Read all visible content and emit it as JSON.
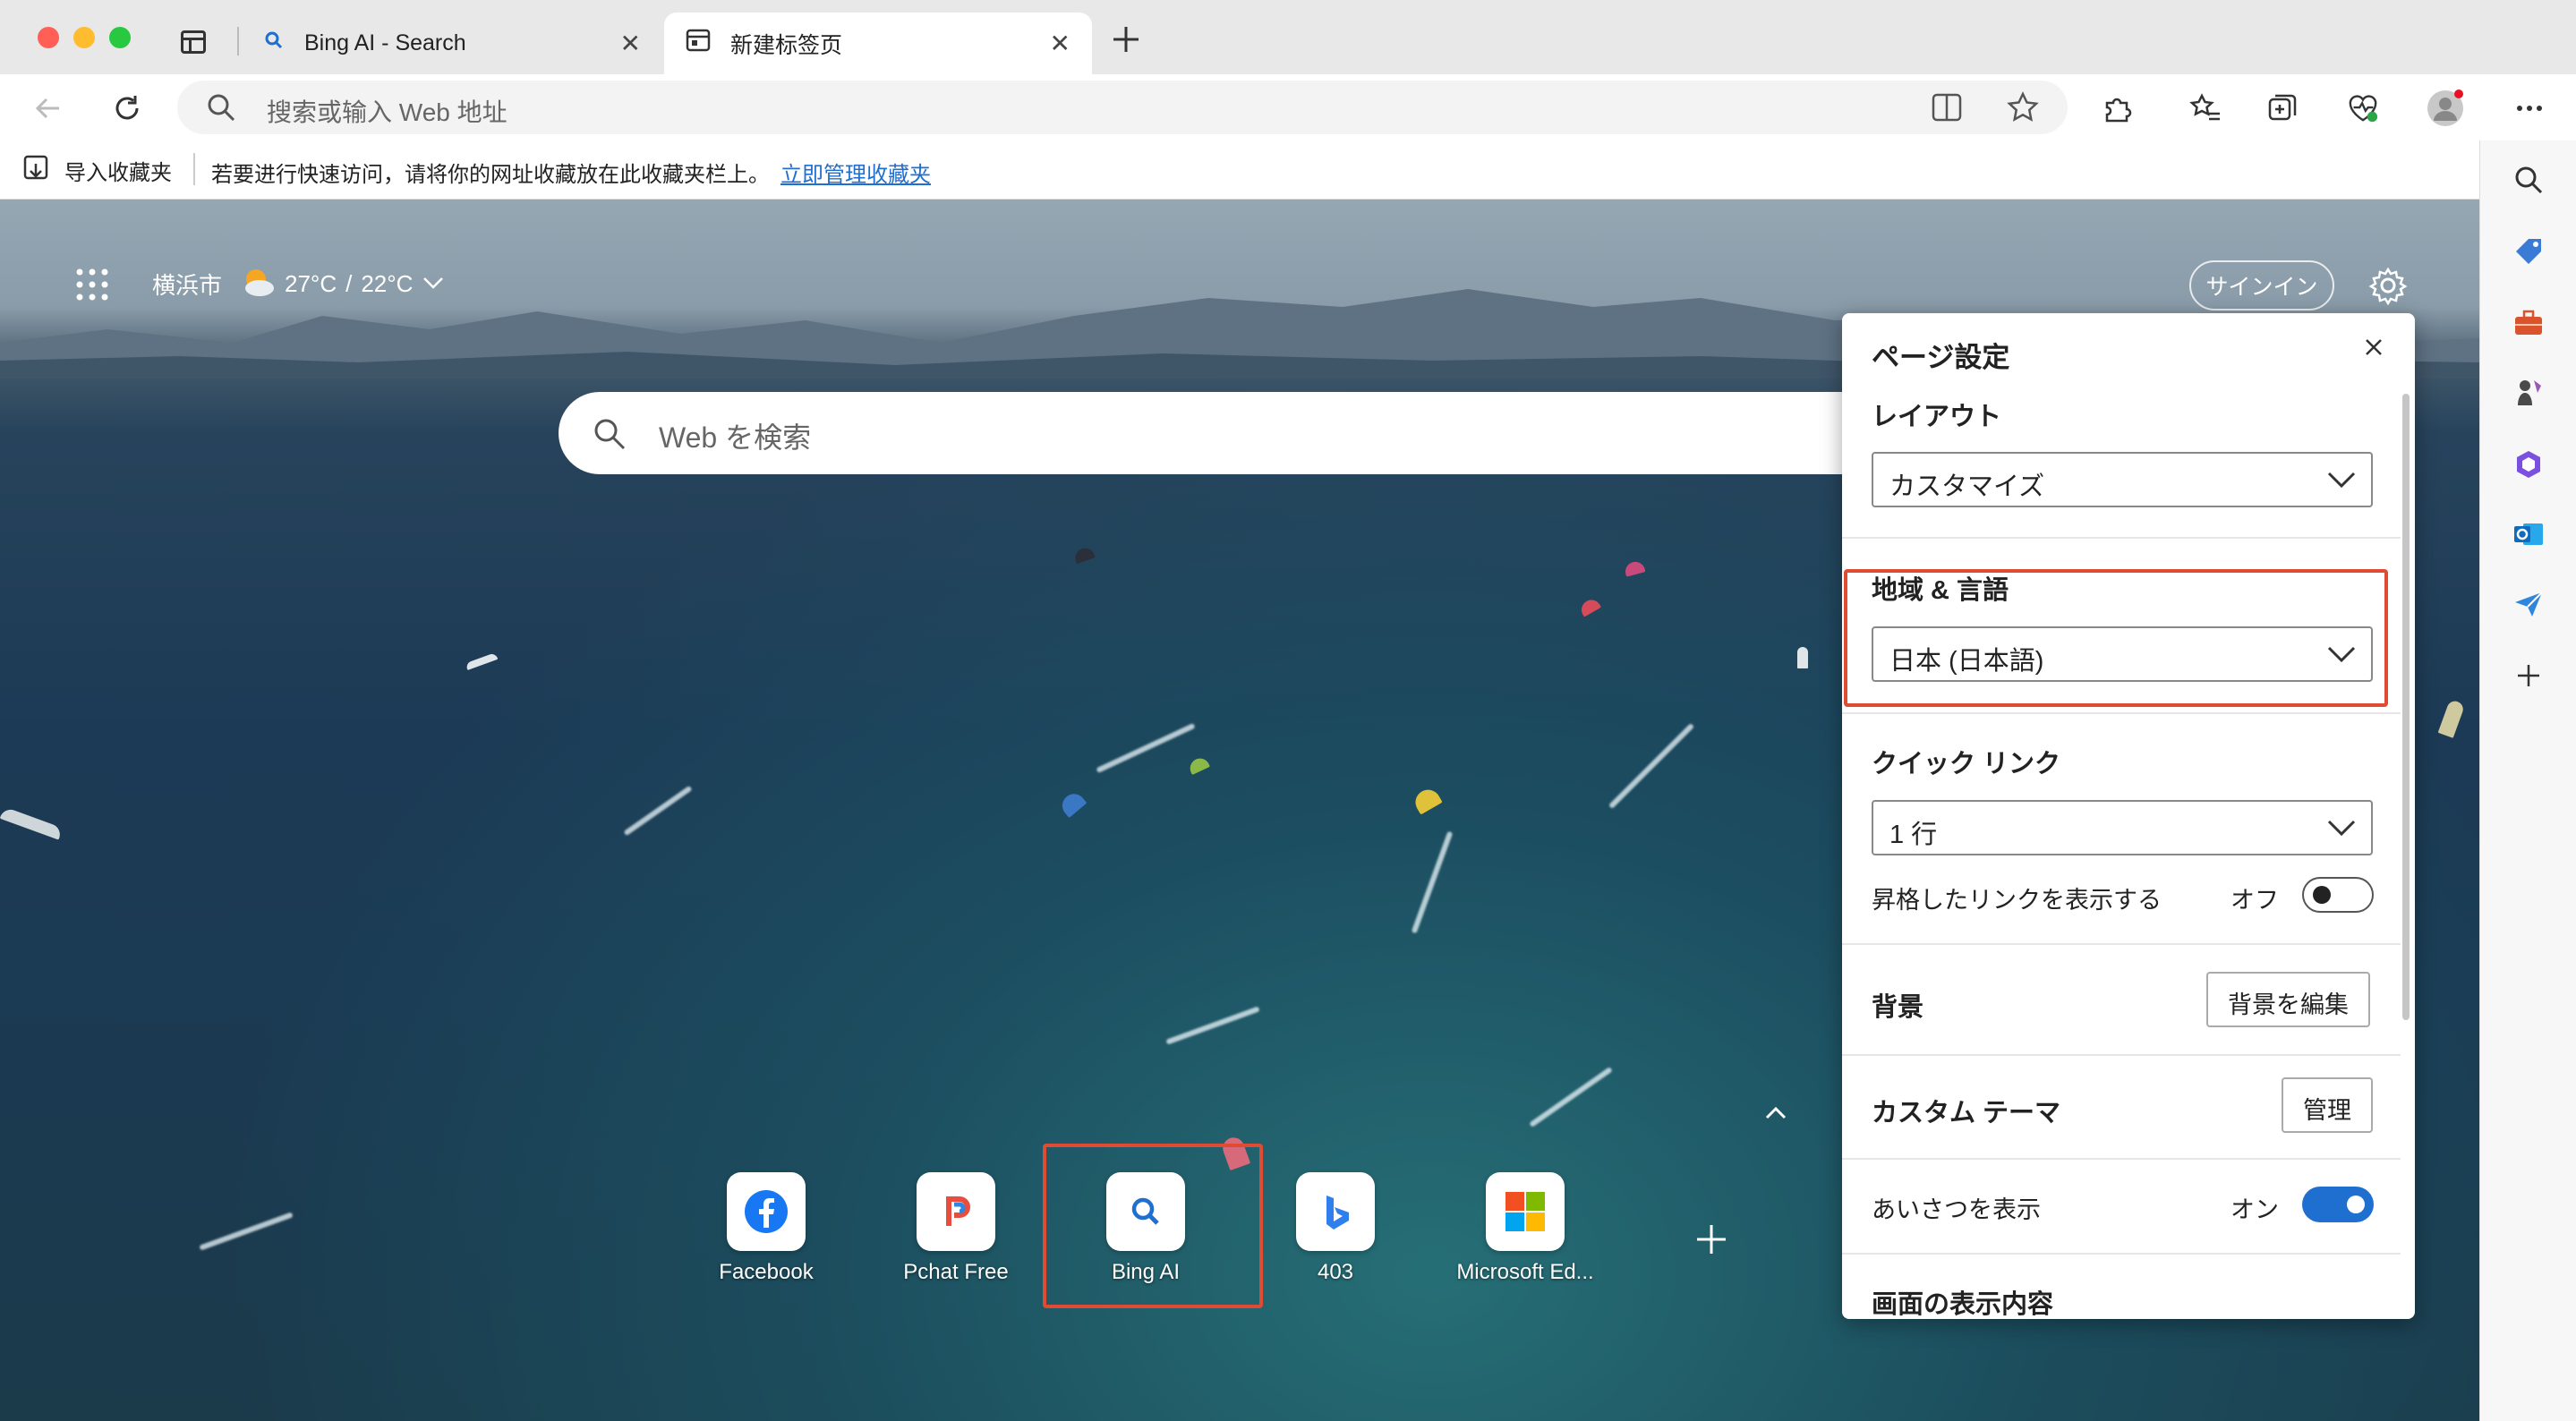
{
  "tabs": [
    {
      "title": "Bing AI - Search",
      "active": false
    },
    {
      "title": "新建标签页",
      "active": true
    }
  ],
  "addressbar": {
    "placeholder": "搜索或输入 Web 地址"
  },
  "favorites_bar": {
    "import_label": "导入收藏夹",
    "message": "若要进行快速访问，请将你的网址收藏放在此收藏夹栏上。",
    "manage_link": "立即管理收藏夹"
  },
  "weather": {
    "city": "横浜市",
    "high": "27°C",
    "separator": "/",
    "low": "22°C"
  },
  "signin_label": "サインイン",
  "search": {
    "placeholder": "Web を検索"
  },
  "quick_links": [
    {
      "label": "Facebook",
      "icon": "facebook-icon"
    },
    {
      "label": "Pchat Free",
      "icon": "pchat-icon"
    },
    {
      "label": "Bing AI",
      "icon": "search-icon"
    },
    {
      "label": "403",
      "icon": "bing-icon"
    },
    {
      "label": "Microsoft Ed...",
      "icon": "microsoft-icon"
    }
  ],
  "settings_panel": {
    "title": "ページ設定",
    "layout": {
      "heading": "レイアウト",
      "value": "カスタマイズ"
    },
    "region": {
      "heading": "地域 & 言語",
      "value": "日本 (日本語)"
    },
    "quick_links": {
      "heading": "クイック リンク",
      "value": "1 行",
      "promoted_label": "昇格したリンクを表示する",
      "promoted_state": "オフ"
    },
    "background": {
      "heading": "背景",
      "button": "背景を編集"
    },
    "theme": {
      "heading": "カスタム テーマ",
      "button": "管理"
    },
    "greeting": {
      "label": "あいさつを表示",
      "state": "オン"
    },
    "display": {
      "heading": "画面の表示内容"
    }
  },
  "colors": {
    "accent": "#1f6fd1",
    "highlight": "#e04b34",
    "toggle_on": "#1f6fd1"
  }
}
